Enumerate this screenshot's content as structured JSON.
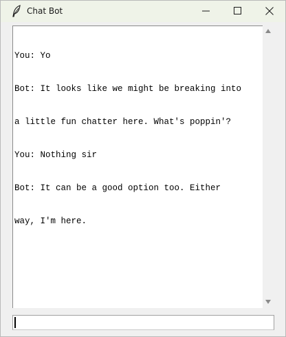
{
  "window": {
    "title": "Chat Bot",
    "app_icon": "feather-icon"
  },
  "controls": {
    "minimize_icon": "minimize-icon",
    "maximize_icon": "maximize-icon",
    "close_icon": "close-icon"
  },
  "chat": {
    "lines": [
      "You: Yo",
      "Bot: It looks like we might be breaking into",
      "a little fun chatter here. What's poppin'?",
      "You: Nothing sir",
      "Bot: It can be a good option too. Either",
      "way, I'm here."
    ]
  },
  "input": {
    "value": ""
  },
  "colors": {
    "titlebar": "#eff3e8",
    "window_bg": "#f0f0f0",
    "text_bg": "#ffffff",
    "text": "#000000"
  }
}
